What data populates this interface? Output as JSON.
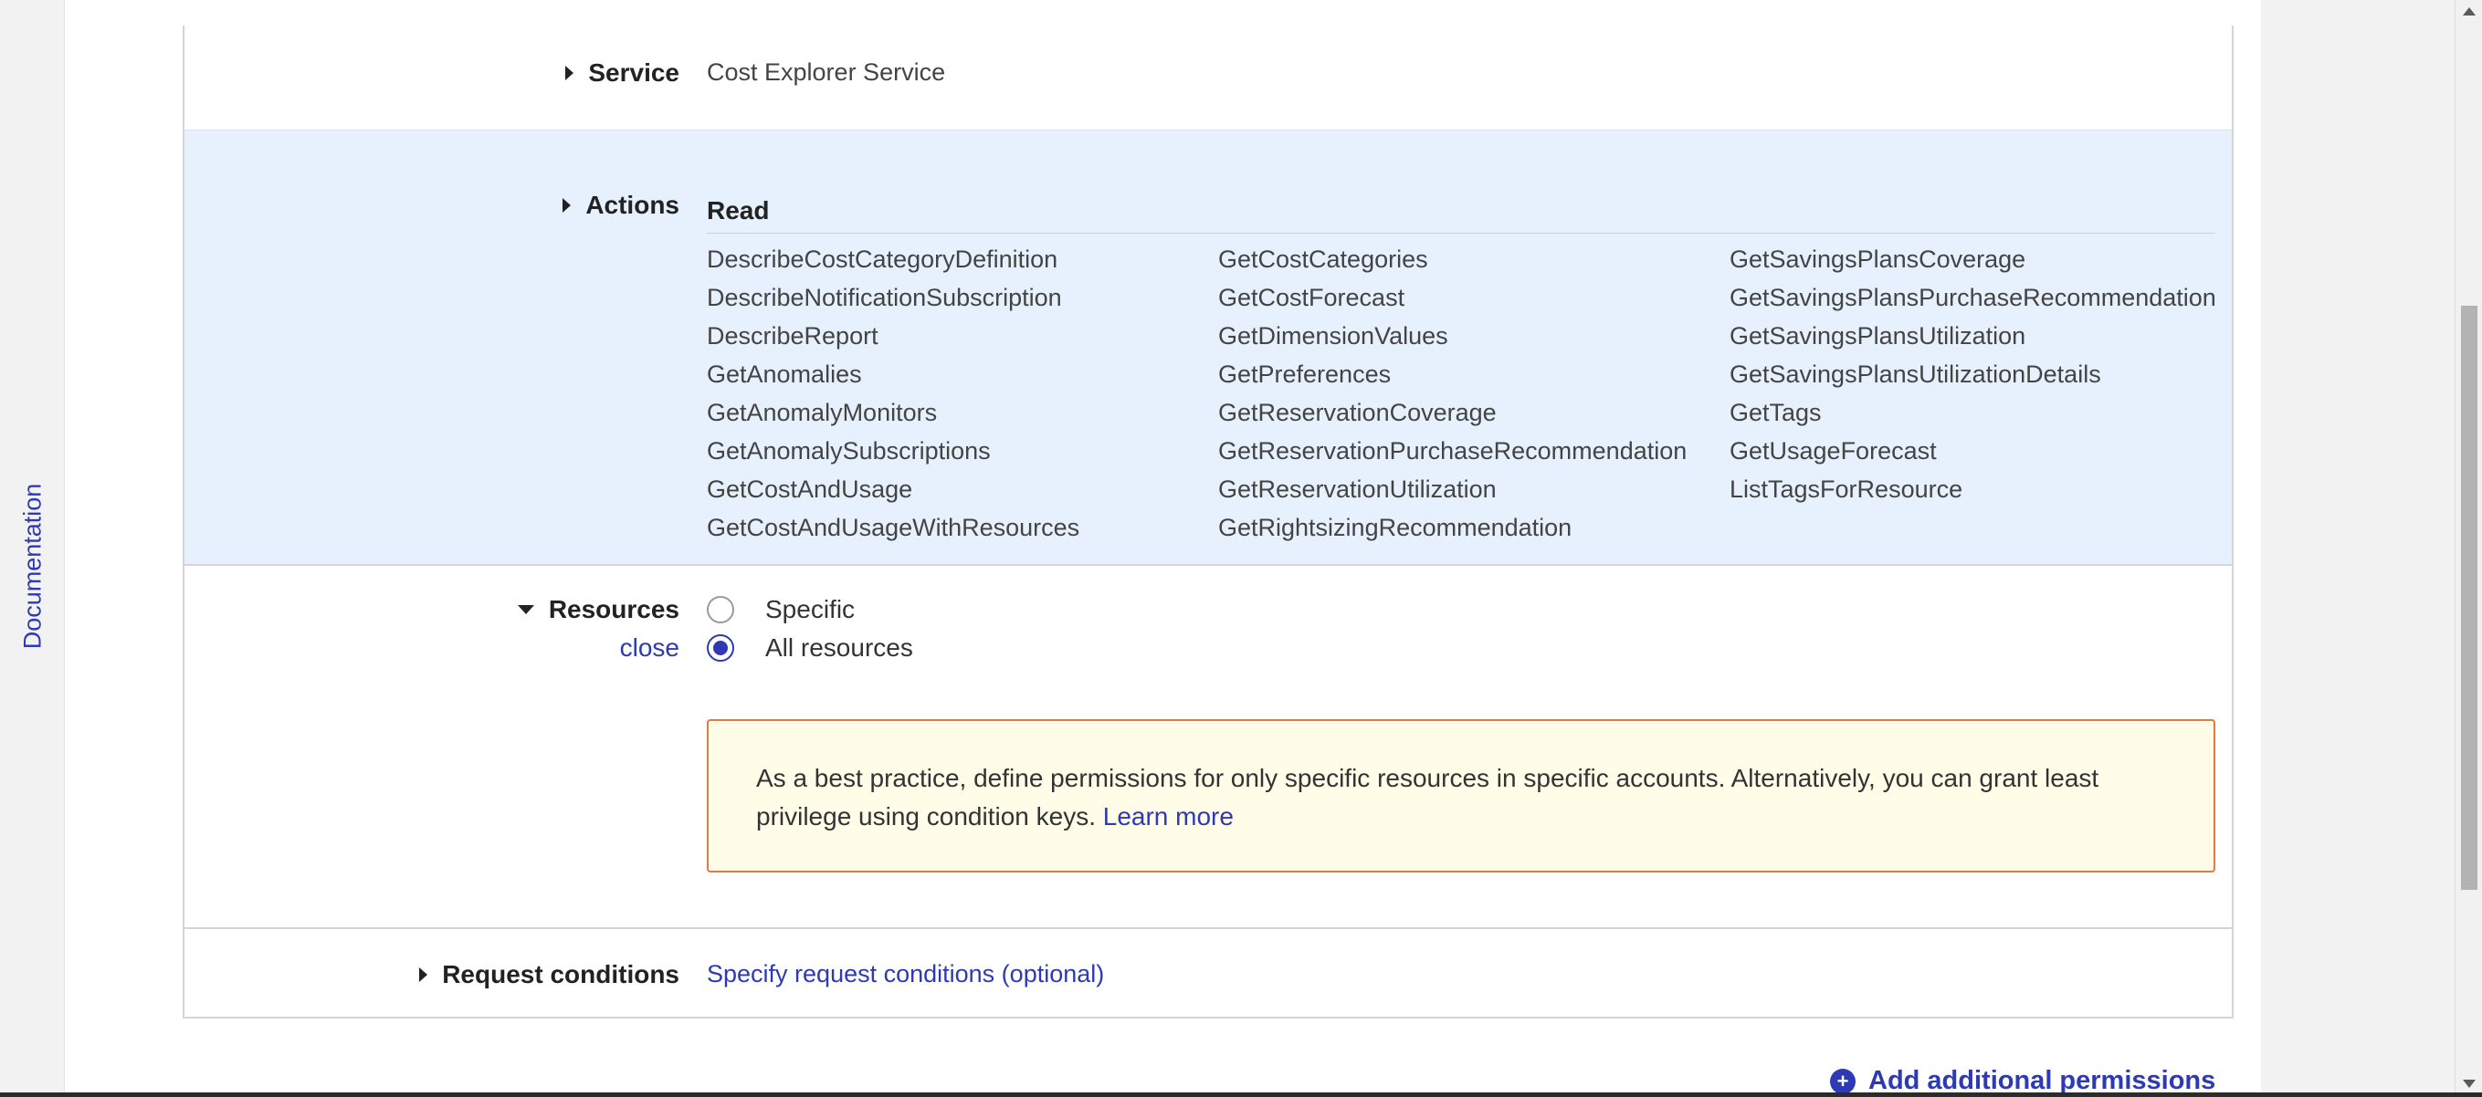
{
  "sidebar": {
    "documentation_label": "Documentation"
  },
  "service": {
    "label": "Service",
    "value": "Cost Explorer Service"
  },
  "actions": {
    "label": "Actions",
    "group": "Read",
    "columns": [
      [
        "DescribeCostCategoryDefinition",
        "DescribeNotificationSubscription",
        "DescribeReport",
        "GetAnomalies",
        "GetAnomalyMonitors",
        "GetAnomalySubscriptions",
        "GetCostAndUsage",
        "GetCostAndUsageWithResources"
      ],
      [
        "GetCostCategories",
        "GetCostForecast",
        "GetDimensionValues",
        "GetPreferences",
        "GetReservationCoverage",
        "GetReservationPurchaseRecommendation",
        "GetReservationUtilization",
        "GetRightsizingRecommendation"
      ],
      [
        "GetSavingsPlansCoverage",
        "GetSavingsPlansPurchaseRecommendation",
        "GetSavingsPlansUtilization",
        "GetSavingsPlansUtilizationDetails",
        "GetTags",
        "GetUsageForecast",
        "ListTagsForResource"
      ]
    ]
  },
  "resources": {
    "label": "Resources",
    "close_label": "close",
    "options": [
      {
        "label": "Specific",
        "checked": false
      },
      {
        "label": "All resources",
        "checked": true
      }
    ],
    "warning_text": "As a best practice, define permissions for only specific resources in specific accounts. Alternatively, you can grant least privilege using condition keys.",
    "warning_link": "Learn more"
  },
  "request_conditions": {
    "label": "Request conditions",
    "link": "Specify request conditions (optional)"
  },
  "footer": {
    "add_more_label": "Add additional permissions"
  },
  "colors": {
    "link": "#2d3ab4",
    "actions_bg": "#e6f1fd",
    "warning_border": "#e07a3f",
    "warning_bg": "#fffce8"
  }
}
